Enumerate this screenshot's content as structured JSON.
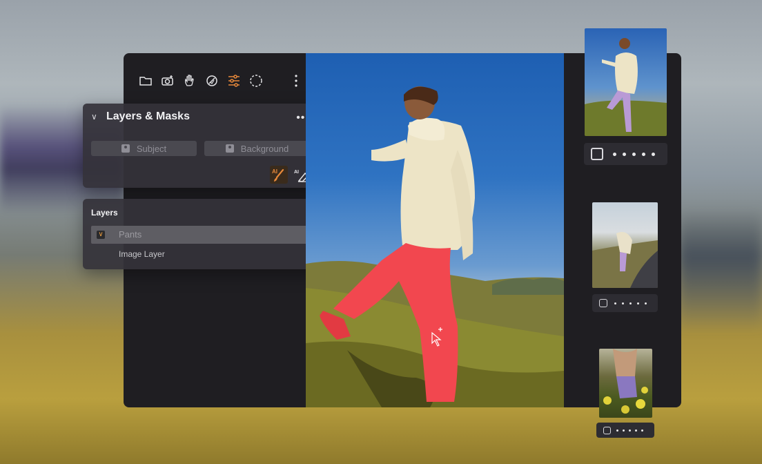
{
  "panels": {
    "masks": {
      "title": "Layers & Masks",
      "subject_label": "Subject",
      "background_label": "Background"
    },
    "layers": {
      "title": "Layers",
      "items": [
        {
          "label": "Pants",
          "checked": true
        },
        {
          "label": "Image Layer"
        }
      ]
    }
  },
  "toolbar": {
    "tools": [
      "folder-icon",
      "camera-icon",
      "hand-icon",
      "circle-brush-icon",
      "sliders-icon",
      "loading-icon",
      "more-vertical-icon"
    ],
    "active_tool": "sliders-icon"
  },
  "filmstrip": {
    "thumbnails": [
      "photo-1",
      "photo-2",
      "photo-3"
    ],
    "dot_count": 5
  },
  "colors": {
    "accent": "#e8893a",
    "panel": "#34323a",
    "window": "#1f1e22",
    "mask_highlight": "#ff4c57"
  }
}
